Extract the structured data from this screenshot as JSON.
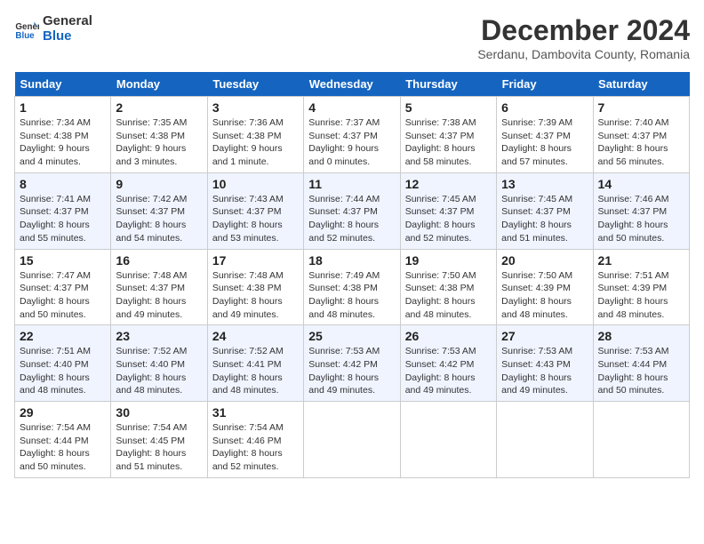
{
  "header": {
    "logo_line1": "General",
    "logo_line2": "Blue",
    "title": "December 2024",
    "subtitle": "Serdanu, Dambovita County, Romania"
  },
  "weekdays": [
    "Sunday",
    "Monday",
    "Tuesday",
    "Wednesday",
    "Thursday",
    "Friday",
    "Saturday"
  ],
  "weeks": [
    [
      {
        "day": "1",
        "sunrise": "Sunrise: 7:34 AM",
        "sunset": "Sunset: 4:38 PM",
        "daylight": "Daylight: 9 hours and 4 minutes."
      },
      {
        "day": "2",
        "sunrise": "Sunrise: 7:35 AM",
        "sunset": "Sunset: 4:38 PM",
        "daylight": "Daylight: 9 hours and 3 minutes."
      },
      {
        "day": "3",
        "sunrise": "Sunrise: 7:36 AM",
        "sunset": "Sunset: 4:38 PM",
        "daylight": "Daylight: 9 hours and 1 minute."
      },
      {
        "day": "4",
        "sunrise": "Sunrise: 7:37 AM",
        "sunset": "Sunset: 4:37 PM",
        "daylight": "Daylight: 9 hours and 0 minutes."
      },
      {
        "day": "5",
        "sunrise": "Sunrise: 7:38 AM",
        "sunset": "Sunset: 4:37 PM",
        "daylight": "Daylight: 8 hours and 58 minutes."
      },
      {
        "day": "6",
        "sunrise": "Sunrise: 7:39 AM",
        "sunset": "Sunset: 4:37 PM",
        "daylight": "Daylight: 8 hours and 57 minutes."
      },
      {
        "day": "7",
        "sunrise": "Sunrise: 7:40 AM",
        "sunset": "Sunset: 4:37 PM",
        "daylight": "Daylight: 8 hours and 56 minutes."
      }
    ],
    [
      {
        "day": "8",
        "sunrise": "Sunrise: 7:41 AM",
        "sunset": "Sunset: 4:37 PM",
        "daylight": "Daylight: 8 hours and 55 minutes."
      },
      {
        "day": "9",
        "sunrise": "Sunrise: 7:42 AM",
        "sunset": "Sunset: 4:37 PM",
        "daylight": "Daylight: 8 hours and 54 minutes."
      },
      {
        "day": "10",
        "sunrise": "Sunrise: 7:43 AM",
        "sunset": "Sunset: 4:37 PM",
        "daylight": "Daylight: 8 hours and 53 minutes."
      },
      {
        "day": "11",
        "sunrise": "Sunrise: 7:44 AM",
        "sunset": "Sunset: 4:37 PM",
        "daylight": "Daylight: 8 hours and 52 minutes."
      },
      {
        "day": "12",
        "sunrise": "Sunrise: 7:45 AM",
        "sunset": "Sunset: 4:37 PM",
        "daylight": "Daylight: 8 hours and 52 minutes."
      },
      {
        "day": "13",
        "sunrise": "Sunrise: 7:45 AM",
        "sunset": "Sunset: 4:37 PM",
        "daylight": "Daylight: 8 hours and 51 minutes."
      },
      {
        "day": "14",
        "sunrise": "Sunrise: 7:46 AM",
        "sunset": "Sunset: 4:37 PM",
        "daylight": "Daylight: 8 hours and 50 minutes."
      }
    ],
    [
      {
        "day": "15",
        "sunrise": "Sunrise: 7:47 AM",
        "sunset": "Sunset: 4:37 PM",
        "daylight": "Daylight: 8 hours and 50 minutes."
      },
      {
        "day": "16",
        "sunrise": "Sunrise: 7:48 AM",
        "sunset": "Sunset: 4:37 PM",
        "daylight": "Daylight: 8 hours and 49 minutes."
      },
      {
        "day": "17",
        "sunrise": "Sunrise: 7:48 AM",
        "sunset": "Sunset: 4:38 PM",
        "daylight": "Daylight: 8 hours and 49 minutes."
      },
      {
        "day": "18",
        "sunrise": "Sunrise: 7:49 AM",
        "sunset": "Sunset: 4:38 PM",
        "daylight": "Daylight: 8 hours and 48 minutes."
      },
      {
        "day": "19",
        "sunrise": "Sunrise: 7:50 AM",
        "sunset": "Sunset: 4:38 PM",
        "daylight": "Daylight: 8 hours and 48 minutes."
      },
      {
        "day": "20",
        "sunrise": "Sunrise: 7:50 AM",
        "sunset": "Sunset: 4:39 PM",
        "daylight": "Daylight: 8 hours and 48 minutes."
      },
      {
        "day": "21",
        "sunrise": "Sunrise: 7:51 AM",
        "sunset": "Sunset: 4:39 PM",
        "daylight": "Daylight: 8 hours and 48 minutes."
      }
    ],
    [
      {
        "day": "22",
        "sunrise": "Sunrise: 7:51 AM",
        "sunset": "Sunset: 4:40 PM",
        "daylight": "Daylight: 8 hours and 48 minutes."
      },
      {
        "day": "23",
        "sunrise": "Sunrise: 7:52 AM",
        "sunset": "Sunset: 4:40 PM",
        "daylight": "Daylight: 8 hours and 48 minutes."
      },
      {
        "day": "24",
        "sunrise": "Sunrise: 7:52 AM",
        "sunset": "Sunset: 4:41 PM",
        "daylight": "Daylight: 8 hours and 48 minutes."
      },
      {
        "day": "25",
        "sunrise": "Sunrise: 7:53 AM",
        "sunset": "Sunset: 4:42 PM",
        "daylight": "Daylight: 8 hours and 49 minutes."
      },
      {
        "day": "26",
        "sunrise": "Sunrise: 7:53 AM",
        "sunset": "Sunset: 4:42 PM",
        "daylight": "Daylight: 8 hours and 49 minutes."
      },
      {
        "day": "27",
        "sunrise": "Sunrise: 7:53 AM",
        "sunset": "Sunset: 4:43 PM",
        "daylight": "Daylight: 8 hours and 49 minutes."
      },
      {
        "day": "28",
        "sunrise": "Sunrise: 7:53 AM",
        "sunset": "Sunset: 4:44 PM",
        "daylight": "Daylight: 8 hours and 50 minutes."
      }
    ],
    [
      {
        "day": "29",
        "sunrise": "Sunrise: 7:54 AM",
        "sunset": "Sunset: 4:44 PM",
        "daylight": "Daylight: 8 hours and 50 minutes."
      },
      {
        "day": "30",
        "sunrise": "Sunrise: 7:54 AM",
        "sunset": "Sunset: 4:45 PM",
        "daylight": "Daylight: 8 hours and 51 minutes."
      },
      {
        "day": "31",
        "sunrise": "Sunrise: 7:54 AM",
        "sunset": "Sunset: 4:46 PM",
        "daylight": "Daylight: 8 hours and 52 minutes."
      },
      null,
      null,
      null,
      null
    ]
  ]
}
